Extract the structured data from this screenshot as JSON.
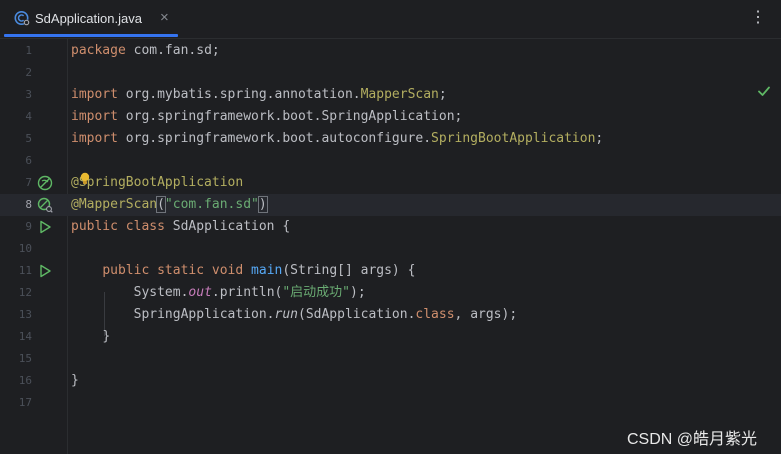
{
  "tab": {
    "title": "SdApplication.java",
    "close": "×",
    "icon": "java-class-icon"
  },
  "toolbar": {
    "more": "⋮"
  },
  "editor": {
    "current_line": 8,
    "lines": [
      {
        "n": "1"
      },
      {
        "n": "2"
      },
      {
        "n": "3"
      },
      {
        "n": "4"
      },
      {
        "n": "5"
      },
      {
        "n": "6"
      },
      {
        "n": "7"
      },
      {
        "n": "8"
      },
      {
        "n": "9"
      },
      {
        "n": "10"
      },
      {
        "n": "11"
      },
      {
        "n": "12"
      },
      {
        "n": "13"
      },
      {
        "n": "14"
      },
      {
        "n": "15"
      },
      {
        "n": "16"
      },
      {
        "n": "17"
      }
    ],
    "tokens": {
      "package_kw": "package",
      "package_name": " com.fan.sd;",
      "import_kw": "import",
      "import1_pre": " org.mybatis.spring.annotation.",
      "import1_cls": "MapperScan",
      "import2": " org.springframework.boot.SpringApplication;",
      "import3_pre": " org.springframework.boot.autoconfigure.",
      "import3_cls": "SpringBootApplication",
      "semi": ";",
      "ann1": "@SpringBootApplication",
      "ann2": "@MapperScan",
      "ann2_open": "(",
      "ann2_str": "\"com.fan.sd\"",
      "ann2_close": ")",
      "public_kw": "public",
      "class_kw": "class",
      "class_name": " SdApplication {",
      "static_kw": "static",
      "void_kw": "void",
      "main_fn": "main",
      "main_params": "(String[] args) {",
      "sys": "System.",
      "out_fld": "out",
      "println": ".println(",
      "println_str": "\"启动成功\"",
      "println_end": ");",
      "springapp": "SpringApplication.",
      "run_fn": "run",
      "run_args_pre": "(SdApplication.",
      "run_args_post": ", args);",
      "close_brace": "}"
    }
  },
  "status": {
    "inspection": "no-problems-check-icon"
  },
  "watermark": "CSDN @皓月紫光"
}
